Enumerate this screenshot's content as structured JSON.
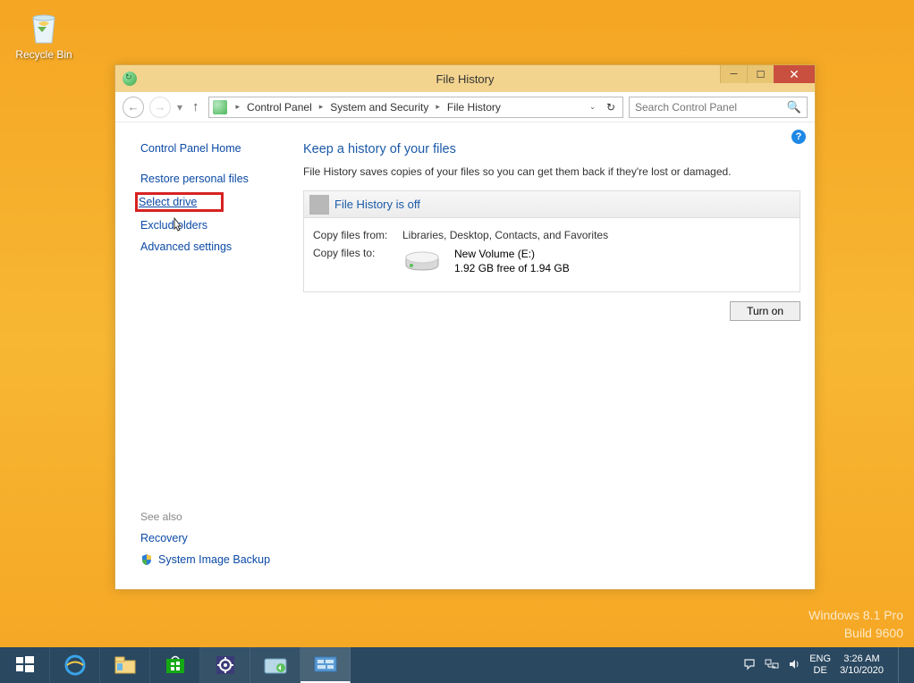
{
  "desktop": {
    "recycle_bin": "Recycle Bin"
  },
  "window": {
    "title": "File History",
    "breadcrumbs": [
      "Control Panel",
      "System and Security",
      "File History"
    ],
    "search_placeholder": "Search Control Panel"
  },
  "sidebar": {
    "home": "Control Panel Home",
    "links": [
      "Restore personal files",
      "Select drive",
      "Exclude folders",
      "Advanced settings"
    ],
    "exclude_folders_cursor": "Exclud      olders",
    "see_also": "See also",
    "recovery": "Recovery",
    "system_image_backup": "System Image Backup"
  },
  "main": {
    "heading": "Keep a history of your files",
    "description": "File History saves copies of your files so you can get them back if they're lost or damaged.",
    "status": "File History is off",
    "copy_from_label": "Copy files from:",
    "copy_from_value": "Libraries, Desktop, Contacts, and Favorites",
    "copy_to_label": "Copy files to:",
    "drive_name": "New Volume (E:)",
    "drive_space": "1.92 GB free of 1.94 GB",
    "turn_on": "Turn on"
  },
  "watermark": {
    "line1": "Windows 8.1 Pro",
    "line2": "Build 9600"
  },
  "taskbar": {
    "lang1": "ENG",
    "lang2": "DE",
    "time": "3:26 AM",
    "date": "3/10/2020"
  }
}
